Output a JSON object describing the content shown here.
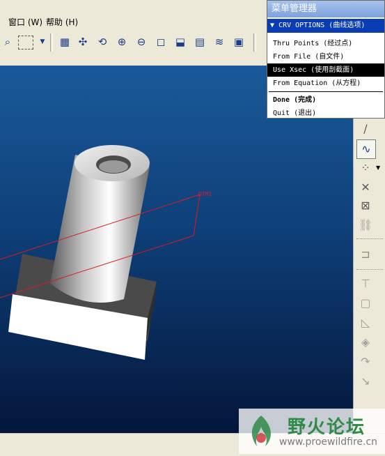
{
  "menubar": {
    "items": [
      {
        "label": "窗口 (W)"
      },
      {
        "label": "帮助 (H)"
      }
    ]
  },
  "toolbar": {
    "icons": [
      "binoculars-icon",
      "select-box-icon",
      "repaint-icon",
      "spin-center-icon",
      "orient-icon",
      "zoom-in-icon",
      "zoom-out-icon",
      "refit-icon",
      "view-manager-icon",
      "named-view-icon",
      "layers-icon",
      "model-tree-icon"
    ]
  },
  "viewport": {
    "datum_label": "DTM1"
  },
  "menu_manager": {
    "title": "菜单管理器",
    "header": "CRV OPTIONS (曲线选项)",
    "options": [
      {
        "label": "Thru Points (经过点)",
        "selected": false
      },
      {
        "label": "From File (自文件)",
        "selected": false
      },
      {
        "label": "Use Xsec (使用剖截面)",
        "selected": true
      },
      {
        "label": "From Equation (从方程)",
        "selected": false
      }
    ],
    "done_label": "Done (完成)",
    "quit_label": "Quit (退出)"
  },
  "right_toolbar": {
    "icons": [
      "datum-plane-icon",
      "datum-curve-icon",
      "datum-point-icon",
      "datum-point-offset-icon",
      "datum-point-field-icon",
      "chain-icon",
      "hole-icon",
      "shell-icon",
      "draft-icon",
      "rib-icon",
      "round-icon",
      "chamfer-icon"
    ]
  },
  "watermark": {
    "title": "野火论坛",
    "url": "www.proewildfire.cn"
  },
  "colors": {
    "menu_header_bg": "#0a3cb4",
    "selected_bg": "#000000",
    "viewport_top": "#1a5a9a",
    "viewport_bottom": "#04163a",
    "datum_line": "#d81c1c"
  }
}
